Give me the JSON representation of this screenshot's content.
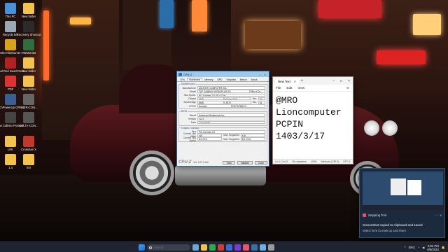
{
  "desktop_icons": [
    {
      "label": "This PC",
      "color": "#4a90d9"
    },
    {
      "label": "New folder",
      "color": "#f2c14e"
    },
    {
      "label": "Recycle Bin",
      "color": "#9aa7b5"
    },
    {
      "label": "Recovery Shortcut",
      "color": "#2b2b2b"
    },
    {
      "label": "MSI Afterburner",
      "color": "#d8a21a"
    },
    {
      "label": "HWMonitor",
      "color": "#2f6f3f"
    },
    {
      "label": "Kerbal Red Dead Rede...",
      "color": "#b22222"
    },
    {
      "label": "New folder",
      "color": "#f2c14e"
    },
    {
      "label": "PDF",
      "color": "#d33"
    },
    {
      "label": "New folder",
      "color": "#f2c14e"
    },
    {
      "label": "TechPowerUp GPU-Z",
      "color": "#3b5f8e"
    },
    {
      "label": "EBER-CON...",
      "color": "#666"
    },
    {
      "label": "The Callisto Protocol",
      "color": "#444"
    },
    {
      "label": "DELTA-CON...",
      "color": "#555"
    },
    {
      "label": "LNK",
      "color": "#f2c14e"
    },
    {
      "label": "Crosshair X",
      "color": "#c0392b"
    },
    {
      "label": "1.4",
      "color": "#f2c14e"
    },
    {
      "label": "hrtr",
      "color": "#f2c14e"
    }
  ],
  "cpuz": {
    "title": "CPU-Z",
    "tabs": [
      "CPU",
      "Mainboard",
      "Memory",
      "SPD",
      "Graphics",
      "Bench",
      "About"
    ],
    "active_tab": "Mainboard",
    "motherboard_legend": "Motherboard",
    "manufacturer_label": "Manufacturer",
    "manufacturer": "ASUSTeK COMPUTER INC.",
    "model_label": "Model",
    "model": "TUF GAMING X570M-PLUS (E)",
    "model_rev": "Rev X.0x",
    "bus_specs_label": "Bus Specs.",
    "bus_specs": "PCI-Express 3.0 (8.0 GT/s)",
    "chipset_label": "Chipset",
    "chipset_vendor": "AMD",
    "chipset_name": "Ryzen SOC",
    "chipset_rev_label": "Rev.",
    "chipset_rev": "00",
    "southbridge_label": "Southbridge",
    "southbridge_vendor": "AMD",
    "southbridge_name": "X570",
    "southbridge_rev_label": "Rev.",
    "southbridge_rev": "51",
    "lpcio_label": "LPCIO",
    "lpcio_vendor": "Nuvoton",
    "lpcio_name": "NCT6798D-R",
    "bios_legend": "BIOS",
    "brand_label": "Brand",
    "brand": "American Megatrends Inc.",
    "version_label": "Version",
    "version": "3403",
    "date_label": "Date",
    "date": "12/13/2023",
    "gfx_legend": "Graphic Interface",
    "bus_label": "Bus",
    "bus": "PCI-Express 3.0",
    "link_width_label": "Current Link Width",
    "link_width": "x16",
    "max_supported_label": "Max. Supported",
    "max_link_width": "x16",
    "link_speed_label": "Current Link Speed",
    "link_speed": "8.0 GT/s",
    "max_link_speed": "8.0 GT/s",
    "brand_logo": "CPU-Z",
    "ver": "Ver. 2.07.0.x64",
    "tools_btn": "Tools",
    "validate_btn": "Validate",
    "close_btn": "Close"
  },
  "notepad": {
    "tab_title": "New Text",
    "menu": [
      "File",
      "Edit",
      "View"
    ],
    "content": "@MRO\nLioncomputer\nPCPIN\n1403/3/17",
    "status_pos": "Ln 4, Col 10",
    "status_chars": "35 characters",
    "status_zoom": "100%",
    "status_eol": "Windows (CRLF)",
    "status_enc": "UTF-8"
  },
  "notification": {
    "app": "Snipping Tool",
    "message": "Screenshot copied to clipboard and saved",
    "sub": "Select here to mark up and share."
  },
  "taskbar": {
    "search_placeholder": "Search",
    "lang": "ENG",
    "time": "6:52 PM",
    "date": "6/6/2024"
  },
  "colors": {
    "taskbar_bg": "#1f2430",
    "cpuz_title": "#9fc9eb"
  }
}
